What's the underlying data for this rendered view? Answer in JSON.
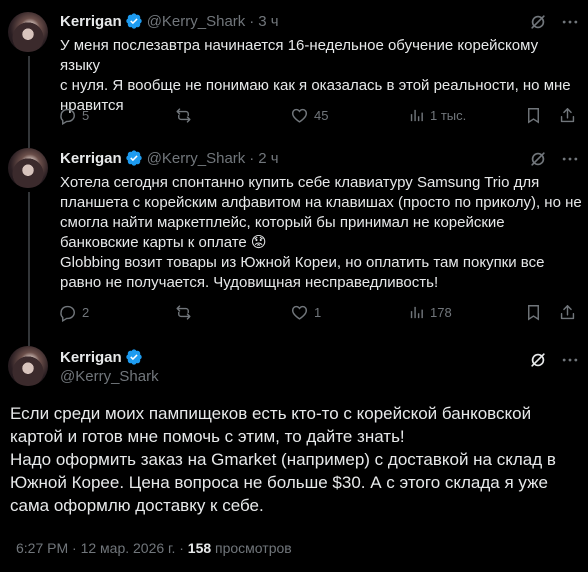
{
  "tweets": [
    {
      "name": "Kerrigan",
      "handle": "@Kerry_Shark",
      "dot": "·",
      "time": "3 ч",
      "text": "У меня послезавтра начинается 16-недельное обучение корейскому языку\nс нуля. Я вообще не понимаю как я оказалась в этой реальности, но мне\nнравится",
      "replies": "5",
      "retweets": "",
      "likes": "45",
      "views": "1 тыс."
    },
    {
      "name": "Kerrigan",
      "handle": "@Kerry_Shark",
      "dot": "·",
      "time": "2 ч",
      "text": "Хотела сегодня спонтанно купить себе клавиатуру Samsung Trio для\nпланшета с корейским алфавитом на клавишах (просто по приколу), но не\nсмогла найти маркетплейс, который бы принимал не корейские\nбанковские карты к оплате 😟\nGlobbing возит товары из Южной Кореи, но оплатить там покупки все\nравно не получается. Чудовищная несправедливость!",
      "replies": "2",
      "retweets": "",
      "likes": "1",
      "views": "178"
    }
  ],
  "main_tweet": {
    "name": "Kerrigan",
    "handle": "@Kerry_Shark",
    "text": "Если среди моих пампищеков есть кто-то с корейской банковской\nкартой и готов мне помочь с этим, то дайте знать!\nНадо оформить заказ на Gmarket (например) с доставкой на склад в\nЮжной Корее. Цена вопроса не больше $30. А с этого склада я уже\nсама оформлю доставку к себе.",
    "timestamp": "6:27 PM · 12 мар. 2026 г. · ",
    "views_count": "158",
    "views_label": " просмотров"
  },
  "colors": {
    "background": "#000000",
    "text": "#e7e9ea",
    "muted": "#71767b",
    "verified": "#1d9bf0",
    "thread_line": "#333639"
  },
  "icons": [
    "verified-badge-icon",
    "grok-icon",
    "more-icon",
    "reply-icon",
    "retweet-icon",
    "like-icon",
    "views-icon",
    "bookmark-icon",
    "share-icon"
  ]
}
